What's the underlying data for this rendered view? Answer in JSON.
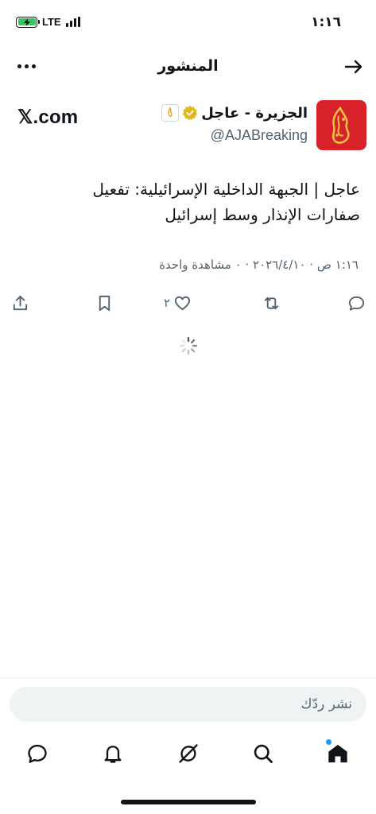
{
  "status_bar": {
    "time": "١:١٦",
    "network": "LTE"
  },
  "header": {
    "title": "المنشور"
  },
  "author": {
    "name": "الجزيرة - عاجل",
    "handle": "@AJABreaking",
    "source": "𝕏.com"
  },
  "post": {
    "text_line1": "عاجل | الجبهة الداخلية الإسرائيلية: تفعيل",
    "text_line2": "صفارات الإنذار وسط إسرائيل",
    "meta": "١:١٦ ص · ٢٠٢٦/٤/١٠ · ٠ مشاهدة واحدة"
  },
  "actions": {
    "like_count": "٢"
  },
  "reply": {
    "placeholder": "نشر ردّك"
  },
  "colors": {
    "text": "#0f1419",
    "secondary": "#536471",
    "accent": "#1d9bf0",
    "avatar_red": "#d7222a",
    "verified_gold": "#e2b719",
    "battery_green": "#34c759"
  },
  "icons": {
    "back": "arrow-right-icon",
    "more": "more-dots-icon",
    "verified": "verified-badge-icon",
    "share": "share-icon",
    "bookmark": "bookmark-icon",
    "like": "heart-icon",
    "repost": "repost-icon",
    "reply": "reply-icon",
    "home": "home-icon",
    "search": "search-icon",
    "grok": "grok-icon",
    "notifications": "bell-icon",
    "messages": "message-icon"
  }
}
